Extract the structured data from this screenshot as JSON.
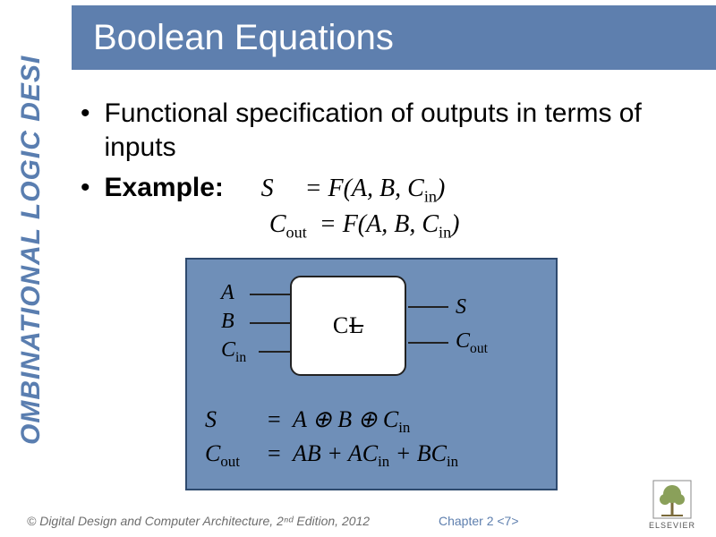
{
  "sidebar_text": "OMBINATIONAL LOGIC DESI",
  "title": "Boolean Equations",
  "bullets": {
    "b1": "Functional specification of outputs in terms of inputs",
    "b2_label": "Example:",
    "b2_eq1_lhs": "S",
    "b2_eq1_rhs_pre": "= F(",
    "b2_eq1_rhs_args": "A, B, C",
    "b2_eq1_rhs_sub": "in",
    "b2_eq1_rhs_post": ")",
    "b2_eq2_lhs": "C",
    "b2_eq2_lhs_sub": "out",
    "b2_eq2_rhs_pre": "= F(",
    "b2_eq2_rhs_args": "A, B, C",
    "b2_eq2_rhs_sub": "in",
    "b2_eq2_rhs_post": ")"
  },
  "diagram": {
    "block_label_c": "C",
    "block_label_l": "L",
    "in1": "A",
    "in2": "B",
    "in3": "C",
    "in3_sub": "in",
    "out1": "S",
    "out2": "C",
    "out2_sub": "out",
    "eq_s_lhs": "S",
    "eq_s_rhs": "A ⊕ B ⊕ C",
    "eq_s_rhs_sub": "in",
    "eq_c_lhs": "C",
    "eq_c_lhs_sub": "out",
    "eq_c_rhs_t1": "AB + AC",
    "eq_c_rhs_s1": "in",
    "eq_c_rhs_t2": " + BC",
    "eq_c_rhs_s2": "in"
  },
  "footer": {
    "copyright_pre": "© Digital Design and Computer Architecture",
    "copyright_post": ", 2ⁿᵈ Edition, 2012",
    "chapter": "Chapter 2 <7>",
    "publisher": "ELSEVIER"
  }
}
